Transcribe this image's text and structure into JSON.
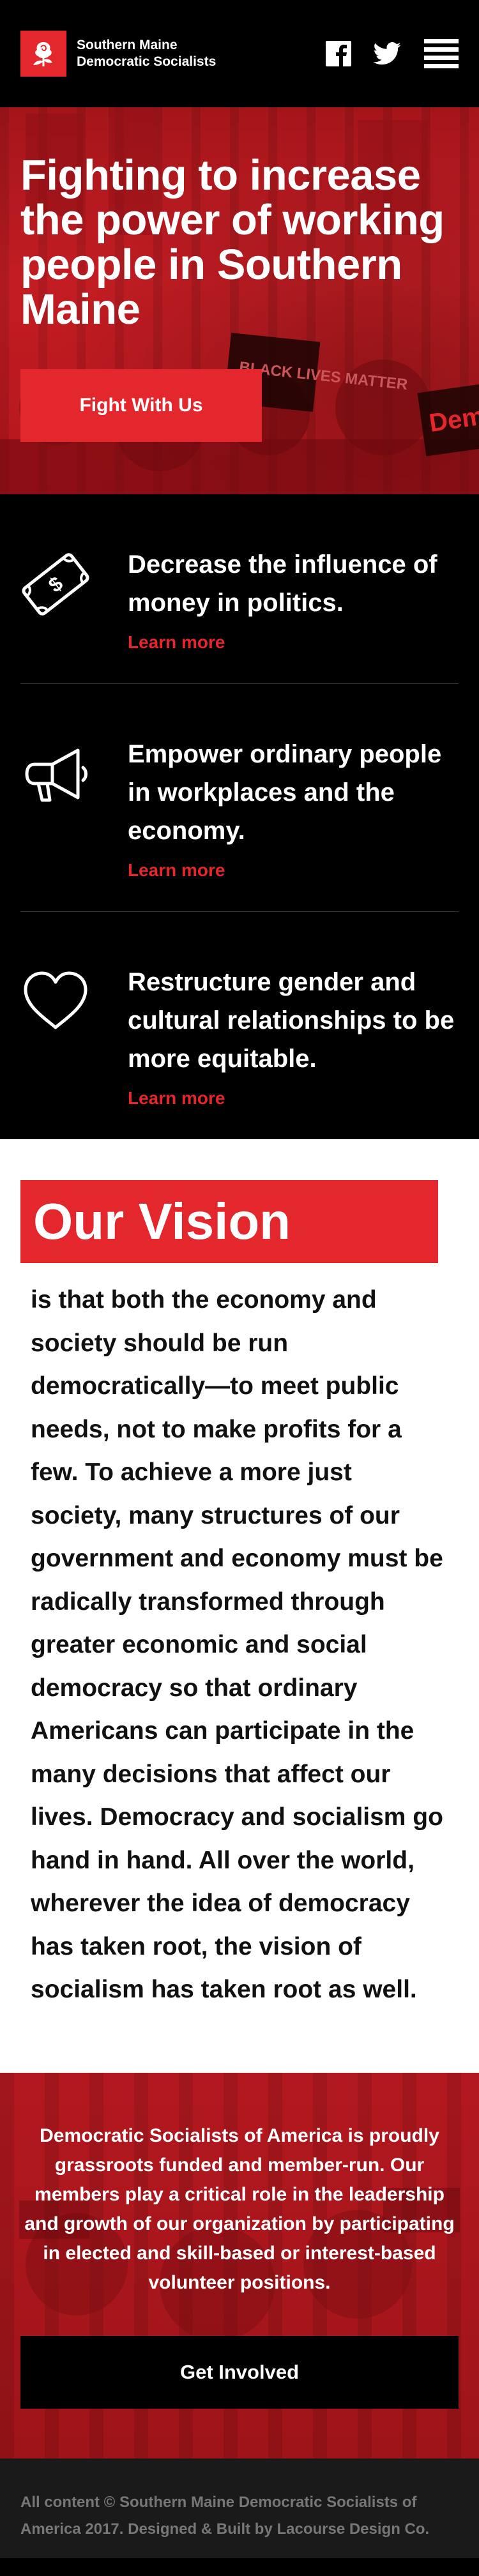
{
  "header": {
    "brand_line1": "Southern Maine",
    "brand_line2": "Democratic Socialists",
    "icons": [
      "rose-logo-icon",
      "facebook-icon",
      "twitter-icon",
      "hamburger-menu-icon"
    ]
  },
  "hero": {
    "title": "Fighting to increase the power of working people in Southern Maine",
    "cta_label": "Fight With Us",
    "sign_left_text": "BLACK LIVES MATTER",
    "sign_right_text": "Dem"
  },
  "values": [
    {
      "icon": "money-bill-icon",
      "text": "Decrease the influence of money in politics.",
      "link": "Learn more"
    },
    {
      "icon": "megaphone-icon",
      "text": "Empower ordinary people in workplaces and the economy.",
      "link": "Learn more"
    },
    {
      "icon": "heart-icon",
      "text": "Restructure gender and cultural relationships to be more equitable.",
      "link": "Learn more"
    }
  ],
  "vision": {
    "title": "Our Vision",
    "text": "is that both the economy and society should be run democratically—to meet public needs, not to make profits for a few. To achieve a more just society, many structures of our government and economy must be radically transformed through greater economic and social democracy so that ordinary Americans can participate in the many decisions that affect our lives. Democracy and socialism go hand in hand. All over the world, wherever the idea of democracy has taken root, the vision of socialism has taken root as well."
  },
  "support": {
    "text": "Democratic Socialists of America is proudly grassroots funded and member-run. Our members play a critical role in the leadership and growth of our organization by participating in elected and skill-based or interest-based volunteer positions.",
    "cta_label": "Get Involved"
  },
  "footer": {
    "text": "All content © Southern Maine Democratic Socialists of America 2017. Designed & Built by Lacourse Design Co."
  },
  "colors": {
    "accent": "#e4262d",
    "dark": "#000000",
    "footer_bg": "#1a1a1a",
    "footer_text": "#777777"
  }
}
